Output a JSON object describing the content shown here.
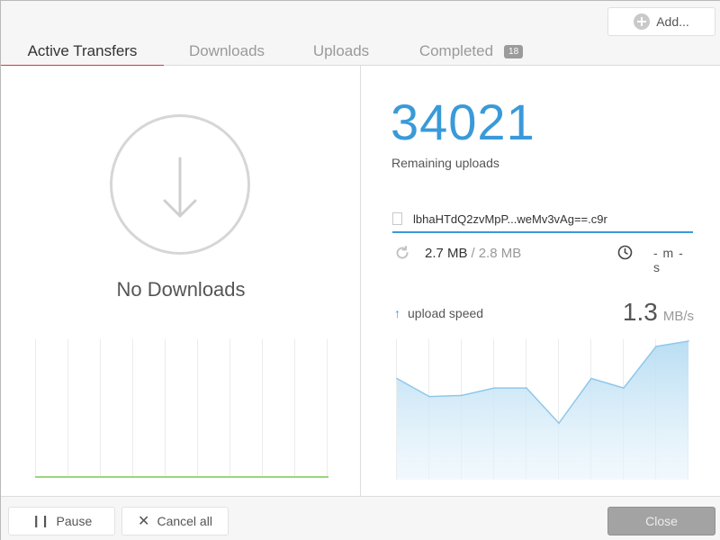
{
  "header": {
    "add_label": "Add...",
    "tabs": [
      {
        "label": "Active Transfers"
      },
      {
        "label": "Downloads"
      },
      {
        "label": "Uploads"
      },
      {
        "label": "Completed",
        "badge": "18"
      }
    ]
  },
  "left": {
    "empty_label": "No Downloads"
  },
  "right": {
    "remaining_count": "34021",
    "remaining_label": "Remaining uploads",
    "file_name": "lbhaHTdQ2zvMpP...weMv3vAg==.c9r",
    "size_current": "2.7 MB",
    "size_separator": "/",
    "size_total": "2.8 MB",
    "time_left": "- m - s",
    "speed_label": "upload speed",
    "speed_value": "1.3",
    "speed_unit": "MB/s"
  },
  "chart_data": {
    "type": "area",
    "series": [
      {
        "values": [
          0.95,
          0.78,
          0.79,
          0.86,
          0.86,
          0.53,
          0.95,
          0.86,
          1.25,
          1.3
        ]
      }
    ],
    "ylim": [
      0,
      1.3
    ]
  },
  "footer": {
    "pause_label": "Pause",
    "cancel_label": "Cancel all",
    "close_label": "Close"
  },
  "colors": {
    "accent": "#3a9ad9",
    "tab_underline": "#e0323c",
    "download_line": "#9bd67d"
  }
}
